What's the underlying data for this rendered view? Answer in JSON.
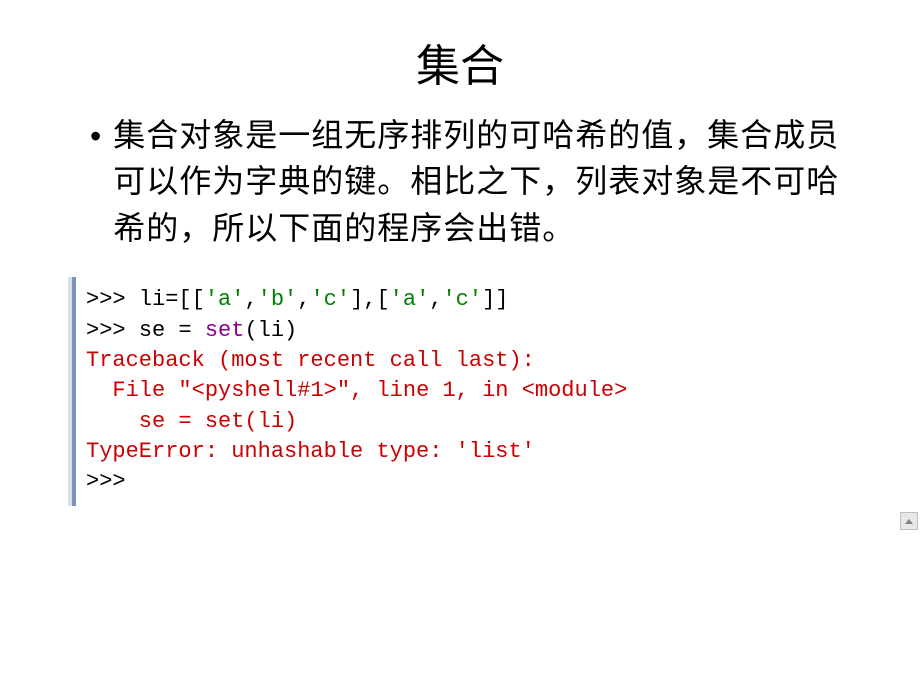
{
  "title": "集合",
  "bullet": "集合对象是一组无序排列的可哈希的值，集合成员可以作为字典的键。相比之下，列表对象是不可哈希的，所以下面的程序会出错。",
  "code": {
    "line1": {
      "prompt": ">>> ",
      "var": "li=[[",
      "s1": "'a'",
      "c1": ",",
      "s2": "'b'",
      "c2": ",",
      "s3": "'c'",
      "c3": "],[",
      "s4": "'a'",
      "c4": ",",
      "s5": "'c'",
      "c5": "]]"
    },
    "line2": {
      "prompt": ">>> ",
      "var": "se = ",
      "fn": "set",
      "paren": "(li)"
    },
    "line3": "Traceback (most recent call last):",
    "line4_a": "  File ",
    "line4_b": "\"<pyshell#1>\"",
    "line4_c": ", line 1, in <module>",
    "line5": "    se = set(li)",
    "line6": "TypeError: unhashable type: 'list'",
    "line7": ">>>"
  }
}
